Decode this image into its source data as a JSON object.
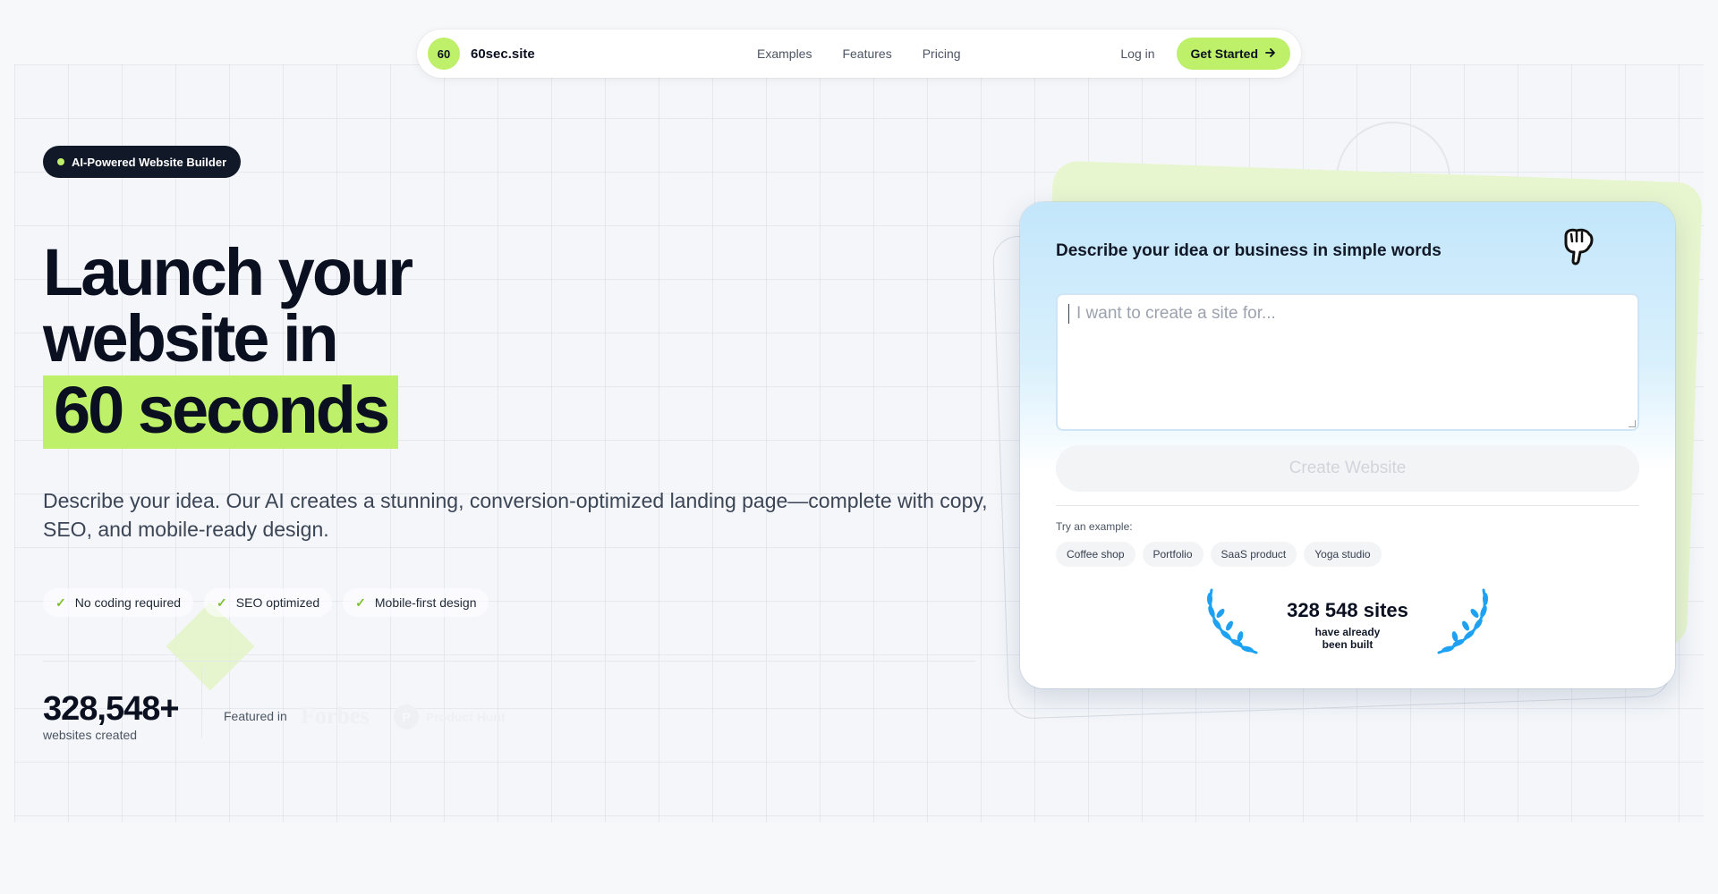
{
  "nav": {
    "logo_badge": "60",
    "logo_text": "60sec.site",
    "links": [
      "Examples",
      "Features",
      "Pricing"
    ],
    "login": "Log in",
    "cta": "Get Started",
    "cta_icon": "arrow-right-icon"
  },
  "hero": {
    "badge": "AI-Powered Website Builder",
    "headline_line1": "Launch your",
    "headline_line2": "website in",
    "headline_highlight": "60 seconds",
    "subtitle": "Describe your idea. Our AI creates a stunning, conversion-optimized landing page—complete with copy, SEO, and mobile-ready design.",
    "checks": [
      "No coding required",
      "SEO optimized",
      "Mobile-first design"
    ],
    "stat_number": "328,548+",
    "stat_label": "websites created",
    "featured_label": "Featured in",
    "featured_logos": [
      "Forbes",
      "Product Hunt"
    ]
  },
  "card": {
    "title": "Describe your idea or business in simple words",
    "textarea_placeholder": "I want to create a site for...",
    "create_button": "Create Website",
    "try_label": "Try an example:",
    "examples": [
      "Coffee shop",
      "Portfolio",
      "SaaS product",
      "Yoga studio"
    ],
    "sites_count": "328 548 sites",
    "sites_sub_line1": "have already",
    "sites_sub_line2": "been built"
  },
  "colors": {
    "accent": "#bff06a",
    "dark": "#0b1020",
    "laurel": "#1da1f2"
  }
}
